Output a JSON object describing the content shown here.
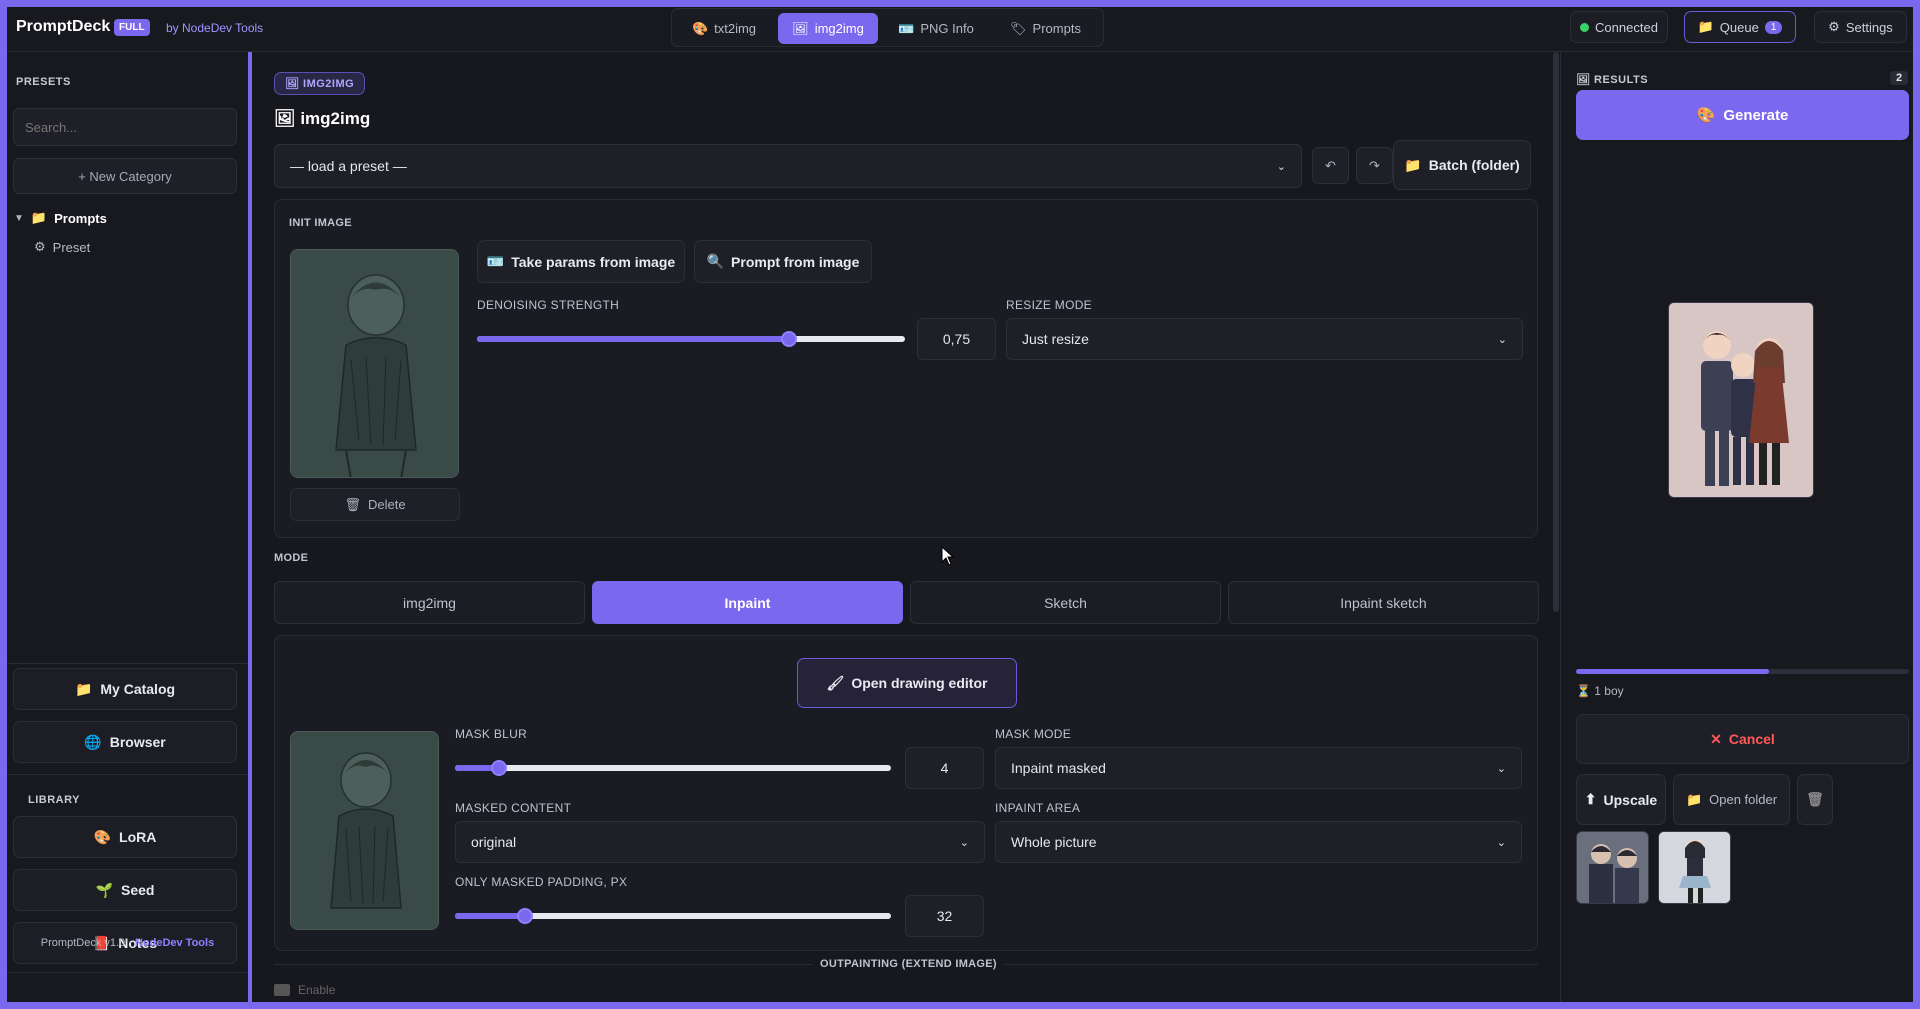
{
  "app": {
    "name": "PromptDeck",
    "edition": "FULL",
    "byline": "by NodeDev Tools"
  },
  "nav_tabs": [
    {
      "label": "txt2img",
      "icon": "palette-icon"
    },
    {
      "label": "img2img",
      "icon": "image-icon"
    },
    {
      "label": "PNG Info",
      "icon": "card-icon"
    },
    {
      "label": "Prompts",
      "icon": "tag-icon"
    }
  ],
  "header": {
    "status": "Connected",
    "queue_label": "Queue",
    "queue_count": "1",
    "settings_label": "Settings"
  },
  "sidebar": {
    "presets_label": "PRESETS",
    "search_placeholder": "Search...",
    "new_category": "+ New Category",
    "tree": {
      "folder": "Prompts",
      "item": "Preset"
    },
    "catalog": "My Catalog",
    "browser": "Browser",
    "library_label": "LIBRARY",
    "library": [
      "LoRA",
      "Seed",
      "Notes"
    ],
    "footer_version": "PromptDeck v1.0 · ",
    "footer_brand": "NodeDev Tools"
  },
  "main": {
    "chip": "IMG2IMG",
    "title": "img2img",
    "preset_select": "— load a preset —",
    "batch_label": "Batch (folder)",
    "init_image_label": "INIT IMAGE",
    "take_params": "Take params from image",
    "prompt_from_image": "Prompt from image",
    "denoising_label": "DENOISING STRENGTH",
    "denoising_value": "0,75",
    "denoising_fraction": 0.73,
    "resize_label": "RESIZE MODE",
    "resize_value": "Just resize",
    "delete_label": "Delete",
    "mode_label": "MODE",
    "modes": [
      "img2img",
      "Inpaint",
      "Sketch",
      "Inpaint sketch"
    ],
    "active_mode": "Inpaint",
    "open_editor": "Open drawing editor",
    "mask_blur_label": "MASK BLUR",
    "mask_blur_value": "4",
    "mask_blur_fraction": 0.1,
    "mask_mode_label": "MASK MODE",
    "mask_mode_value": "Inpaint masked",
    "masked_content_label": "MASKED CONTENT",
    "masked_content_value": "original",
    "inpaint_area_label": "INPAINT AREA",
    "inpaint_area_value": "Whole picture",
    "padding_label": "ONLY MASKED PADDING, PX",
    "padding_value": "32",
    "padding_fraction": 0.16,
    "outpainting_label": "OUTPAINTING (EXTEND IMAGE)",
    "enable_label": "Enable"
  },
  "results": {
    "label": "RESULTS",
    "count": "2",
    "generate": "Generate",
    "progress_fraction": 0.58,
    "progress_text": "1 boy",
    "cancel": "Cancel",
    "upscale": "Upscale",
    "open_folder": "Open folder"
  },
  "colors": {
    "accent": "#7b68ee",
    "bg": "#17171e",
    "status_ok": "#3ad36b",
    "danger": "#ff5a5a"
  }
}
